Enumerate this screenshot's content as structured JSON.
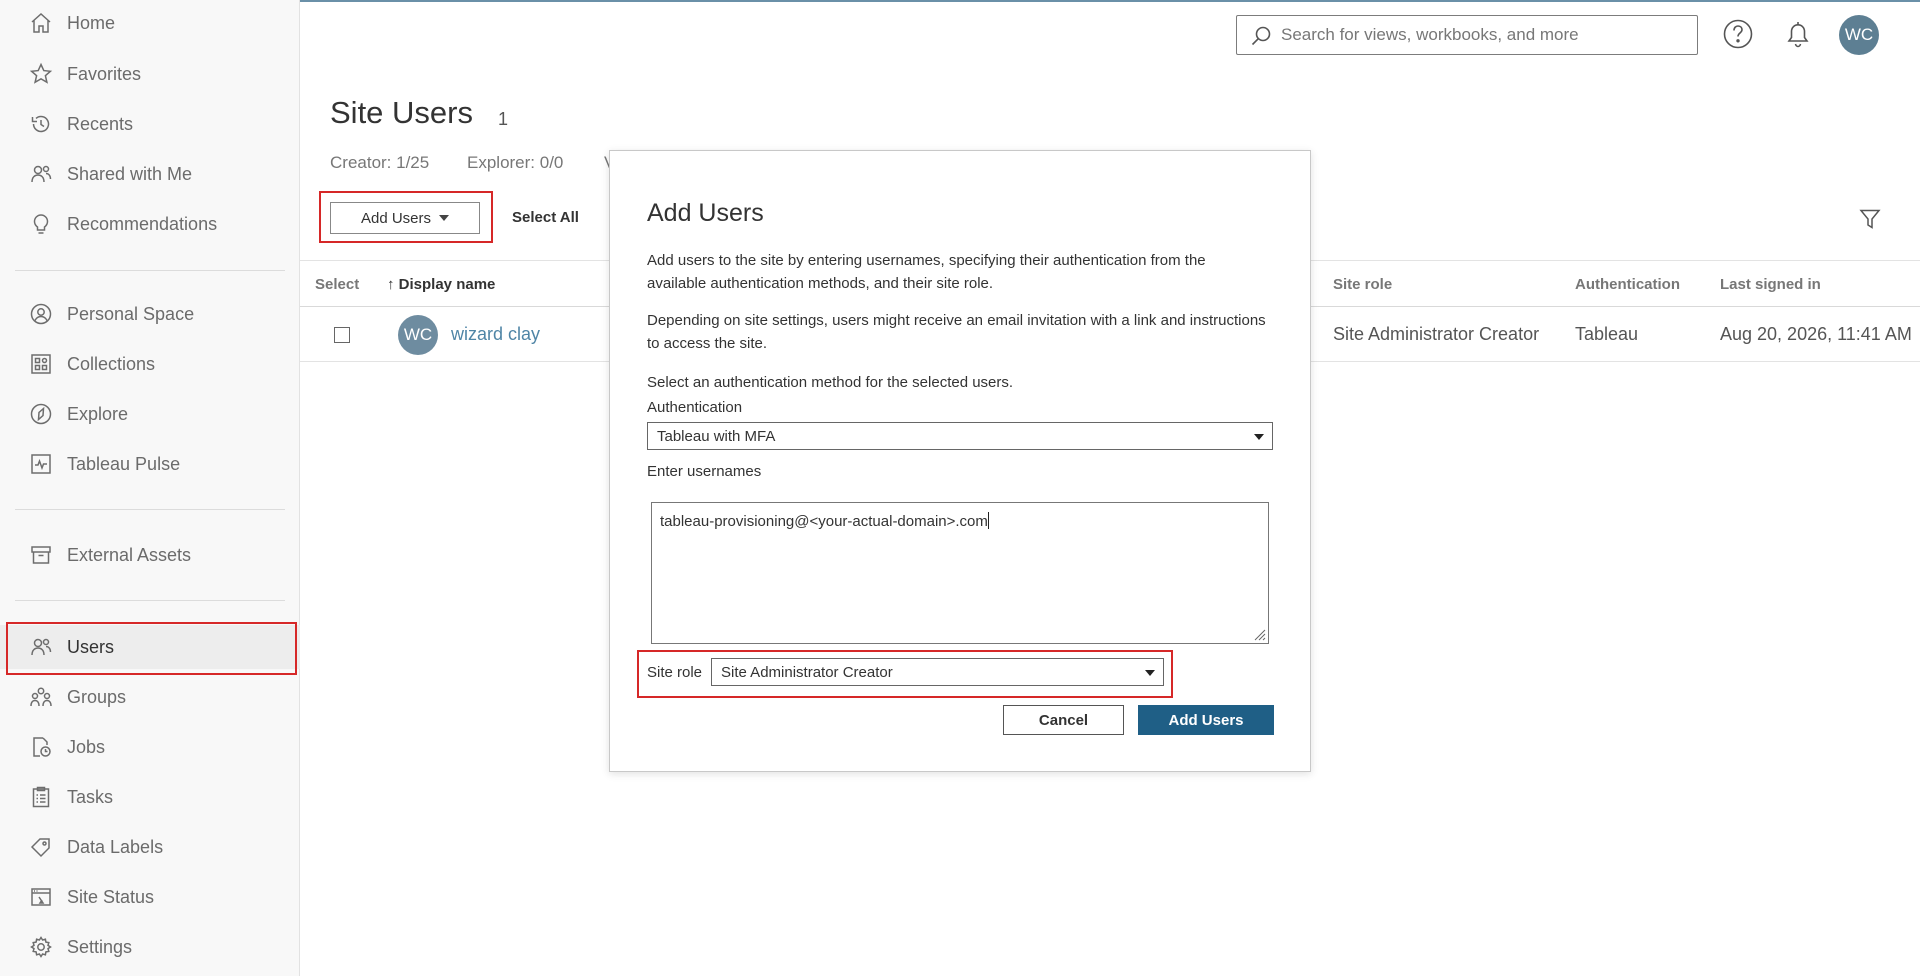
{
  "sidebar": {
    "items": [
      {
        "label": "Home",
        "icon": "home-icon"
      },
      {
        "label": "Favorites",
        "icon": "star-icon"
      },
      {
        "label": "Recents",
        "icon": "history-icon"
      },
      {
        "label": "Shared with Me",
        "icon": "shared-users-icon"
      },
      {
        "label": "Recommendations",
        "icon": "lightbulb-icon"
      },
      {
        "label": "Personal Space",
        "icon": "person-circle-icon"
      },
      {
        "label": "Collections",
        "icon": "collections-icon"
      },
      {
        "label": "Explore",
        "icon": "compass-icon"
      },
      {
        "label": "Tableau Pulse",
        "icon": "pulse-icon"
      },
      {
        "label": "External Assets",
        "icon": "archive-box-icon"
      },
      {
        "label": "Users",
        "icon": "users-icon"
      },
      {
        "label": "Groups",
        "icon": "groups-icon"
      },
      {
        "label": "Jobs",
        "icon": "jobs-icon"
      },
      {
        "label": "Tasks",
        "icon": "clipboard-icon"
      },
      {
        "label": "Data Labels",
        "icon": "tag-icon"
      },
      {
        "label": "Site Status",
        "icon": "site-status-icon"
      },
      {
        "label": "Settings",
        "icon": "gear-icon"
      }
    ],
    "active": "Users"
  },
  "header": {
    "search_placeholder": "Search for views, workbooks, and more",
    "avatar_initials": "WC"
  },
  "page": {
    "title": "Site Users",
    "count": "1",
    "licenses": [
      "Creator: 1/25",
      "Explorer: 0/0",
      "V"
    ],
    "add_users_label": "Add Users",
    "select_all_label": "Select All"
  },
  "table": {
    "columns": [
      "Select",
      "↑ Display name",
      "Site role",
      "Authentication",
      "Last signed in"
    ],
    "rows": [
      {
        "initials": "WC",
        "display_name": "wizard clay",
        "site_role": "Site Administrator Creator",
        "authentication": "Tableau",
        "last_signed_in": "Aug 20, 2026, 11:41 AM"
      }
    ]
  },
  "dialog": {
    "title": "Add Users",
    "intro": "Add users to the site by entering usernames, specifying their authentication from the available authentication methods, and their site role.",
    "notice": "Depending on site settings, users might receive an email invitation with a link and instructions to access the site.",
    "auth_prompt": "Select an authentication method for the selected users.",
    "auth_label": "Authentication",
    "auth_value": "Tableau with MFA",
    "usernames_label": "Enter usernames",
    "usernames_value": "tableau-provisioning@<your-actual-domain>.com",
    "site_role_label": "Site role",
    "site_role_value": "Site Administrator Creator",
    "cancel_label": "Cancel",
    "submit_label": "Add Users"
  },
  "colors": {
    "primary": "#1f5f86",
    "avatar": "#5d7f93",
    "highlight": "#d62828",
    "link": "#4f85a6"
  }
}
